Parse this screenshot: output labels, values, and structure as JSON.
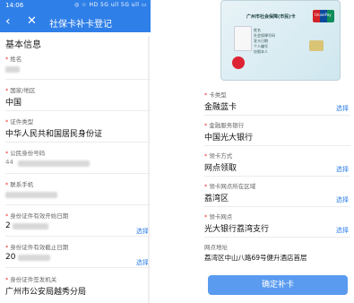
{
  "left": {
    "status_time": "14:06",
    "status_icons": "◎ ☆ HD 5G ull 5G ull ▭",
    "title": "社保卡补卡登记",
    "section": "基本信息",
    "fields": [
      {
        "label": "姓名",
        "value": ""
      },
      {
        "label": "国家/地区",
        "value": "中国"
      },
      {
        "label": "证件类型",
        "value": "中华人民共和国居民身份证"
      },
      {
        "label": "公民身份号码",
        "value": "44"
      },
      {
        "label": "联系手机",
        "value": ""
      },
      {
        "label": "身份证件有效开始日期",
        "value": "2",
        "pick": "选择"
      },
      {
        "label": "身份证件有效截止日期",
        "value": "20",
        "pick": "选择"
      },
      {
        "label": "身份证件签发机关",
        "value": "广州市公安局越秀分局"
      }
    ]
  },
  "right": {
    "card": {
      "title": "广州市社会保障(市民)卡",
      "brand": "UnionPay",
      "rows": [
        "姓名",
        "社会保障号码",
        "发卡日期",
        "个人编号",
        "仅限本人"
      ]
    },
    "fields": [
      {
        "label": "卡类型",
        "value": "金融蓝卡",
        "pick": "选择"
      },
      {
        "label": "金融服务银行",
        "value": "中国光大银行",
        "pick": ""
      },
      {
        "label": "领卡方式",
        "value": "网点领取",
        "pick": "选择"
      },
      {
        "label": "领卡网点所在区域",
        "value": "荔湾区",
        "pick": "选择"
      },
      {
        "label": "领卡网点",
        "value": "光大银行荔湾支行",
        "pick": "选择"
      },
      {
        "label": "网点地址",
        "value": "荔湾区中山八路69号健升酒店首层",
        "pick": ""
      }
    ],
    "confirm_label": "确定补卡"
  },
  "colors": {
    "accent": "#2f7fe8",
    "required": "#e33"
  }
}
